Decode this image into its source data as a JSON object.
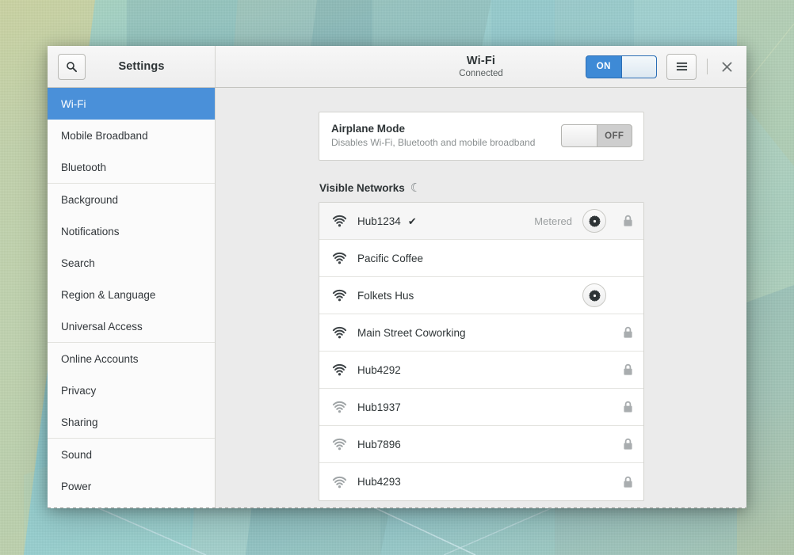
{
  "window": {
    "sidebar_header_title": "Settings",
    "search_icon": "search-icon",
    "header": {
      "title": "Wi-Fi",
      "subtitle": "Connected",
      "wifi_switch_state": "ON",
      "menu_icon": "hamburger-menu-icon",
      "close_icon": "close-icon"
    },
    "accent_color": "#4a90d9",
    "switch_on_color": "#3e8ad6",
    "switch_off_color": "#cecece"
  },
  "sidebar": {
    "groups": [
      {
        "items": [
          {
            "label": "Wi-Fi",
            "selected": true
          },
          {
            "label": "Mobile Broadband",
            "selected": false
          },
          {
            "label": "Bluetooth",
            "selected": false
          }
        ]
      },
      {
        "items": [
          {
            "label": "Background",
            "selected": false
          },
          {
            "label": "Notifications",
            "selected": false
          },
          {
            "label": "Search",
            "selected": false
          },
          {
            "label": "Region & Language",
            "selected": false
          },
          {
            "label": "Universal Access",
            "selected": false
          }
        ]
      },
      {
        "items": [
          {
            "label": "Online Accounts",
            "selected": false
          },
          {
            "label": "Privacy",
            "selected": false
          },
          {
            "label": "Sharing",
            "selected": false
          }
        ]
      },
      {
        "items": [
          {
            "label": "Sound",
            "selected": false
          },
          {
            "label": "Power",
            "selected": false
          }
        ]
      }
    ]
  },
  "main": {
    "airplane_mode": {
      "title": "Airplane Mode",
      "description": "Disables Wi-Fi, Bluetooth and mobile broadband",
      "switch_state": "OFF"
    },
    "visible_networks": {
      "heading": "Visible Networks",
      "spinner_icon": "loading-spinner-icon",
      "rows": [
        {
          "name": "Hub1234",
          "signal": 4,
          "connected": true,
          "metered": "Metered",
          "has_gear": true,
          "locked": true,
          "selected": true
        },
        {
          "name": "Pacific Coffee",
          "signal": 4,
          "connected": false,
          "metered": "",
          "has_gear": false,
          "locked": false,
          "selected": false
        },
        {
          "name": "Folkets Hus",
          "signal": 4,
          "connected": false,
          "metered": "",
          "has_gear": true,
          "locked": false,
          "selected": false
        },
        {
          "name": "Main Street Coworking",
          "signal": 4,
          "connected": false,
          "metered": "",
          "has_gear": false,
          "locked": true,
          "selected": false
        },
        {
          "name": "Hub4292",
          "signal": 4,
          "connected": false,
          "metered": "",
          "has_gear": false,
          "locked": true,
          "selected": false
        },
        {
          "name": "Hub1937",
          "signal": 2,
          "connected": false,
          "metered": "",
          "has_gear": false,
          "locked": true,
          "selected": false
        },
        {
          "name": "Hub7896",
          "signal": 2,
          "connected": false,
          "metered": "",
          "has_gear": false,
          "locked": true,
          "selected": false
        },
        {
          "name": "Hub4293",
          "signal": 2,
          "connected": false,
          "metered": "",
          "has_gear": false,
          "locked": true,
          "selected": false
        }
      ]
    }
  }
}
